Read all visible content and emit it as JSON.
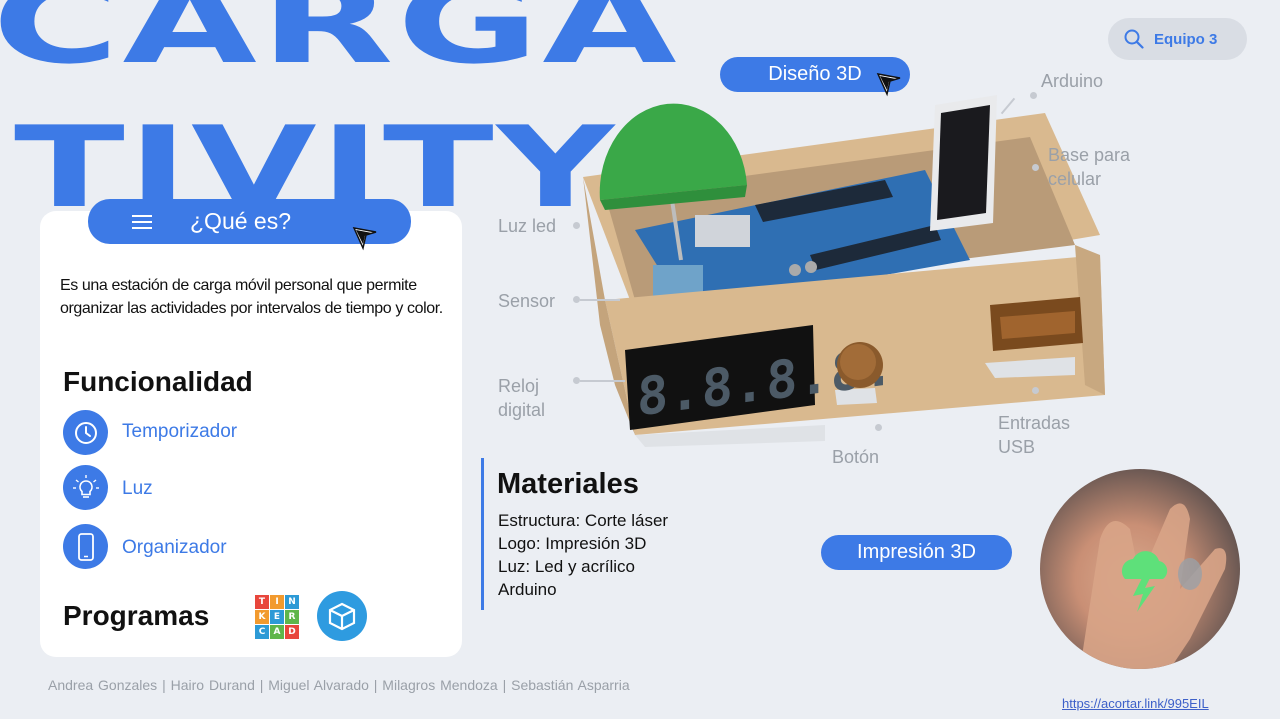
{
  "title": {
    "line1": "CARGA",
    "line2": "TIVITY"
  },
  "search": {
    "label": "Equipo 3",
    "icon": "search-icon"
  },
  "pills": {
    "design3d": "Diseño 3D",
    "print3d": "Impresión 3D"
  },
  "card": {
    "header": "¿Qué es?",
    "description": "Es una estación de carga móvil personal que permite organizar las actividades por intervalos de tiempo y color.",
    "functionality_title": "Funcionalidad",
    "functions": [
      {
        "label": "Temporizador",
        "icon": "clock-icon"
      },
      {
        "label": "Luz",
        "icon": "lightbulb-icon"
      },
      {
        "label": "Organizador",
        "icon": "phone-icon"
      }
    ],
    "programs_title": "Programas",
    "tinkercad_letters": [
      "T",
      "I",
      "N",
      "K",
      "E",
      "R",
      "C",
      "A",
      "D"
    ]
  },
  "parts": {
    "arduino": "Arduino",
    "base_line1": "Base para",
    "base_line2": "celular",
    "luz_led": "Luz led",
    "sensor": "Sensor",
    "reloj_line1": "Reloj",
    "reloj_line2": "digital",
    "boton": "Botón",
    "usb_line1": "Entradas",
    "usb_line2": "USB",
    "clock_digits": "8.8.8.8."
  },
  "materials": {
    "title": "Materiales",
    "items": [
      "Estructura: Corte láser",
      "Logo: Impresión 3D",
      "Luz: Led y acrílico",
      "Arduino"
    ]
  },
  "footer": {
    "authors": "Andrea Gonzales  |  Hairo Durand  |  Miguel Alvarado |  Milagros Mendoza  |  Sebastián Asparria",
    "link": "https://acortar.link/995EIL"
  },
  "colors": {
    "accent": "#3d7ae6",
    "background": "#ebeef3",
    "card": "#ffffff"
  }
}
